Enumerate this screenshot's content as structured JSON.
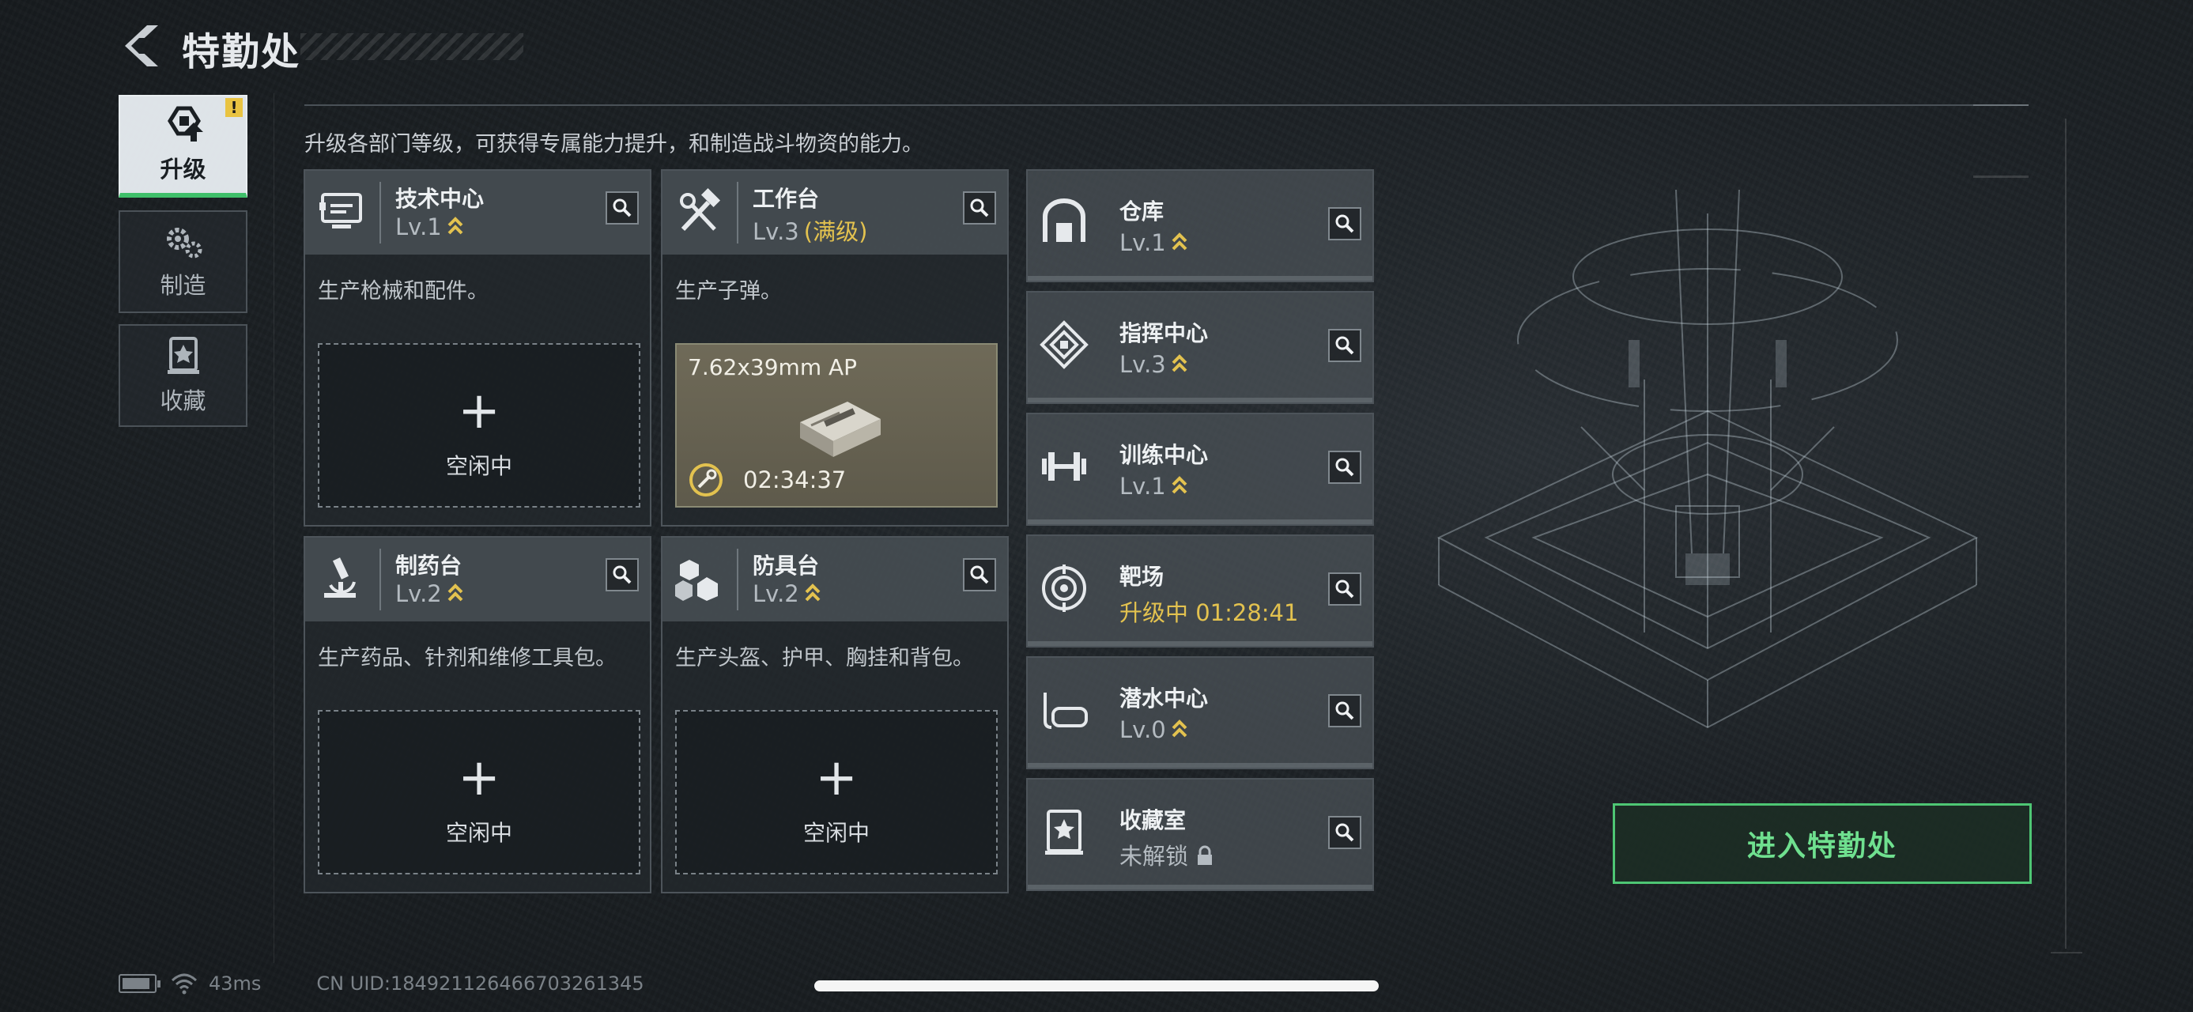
{
  "header": {
    "title": "特勤处"
  },
  "nav": {
    "items": [
      {
        "label": "升级",
        "active": true,
        "badge": "!"
      },
      {
        "label": "制造",
        "active": false
      },
      {
        "label": "收藏",
        "active": false
      }
    ]
  },
  "intro": "升级各部门等级，可获得专属能力提升，和制造战斗物资的能力。",
  "cards": [
    {
      "name": "技术中心",
      "level": "Lv.1",
      "desc": "生产枪械和配件。",
      "slot": {
        "state": "idle",
        "label": "空闲中",
        "plus": "+"
      }
    },
    {
      "name": "工作台",
      "level": "Lv.3",
      "max_label": "(满级)",
      "desc": "生产子弹。",
      "slot": {
        "state": "producing",
        "item": "7.62x39mm AP",
        "timer": "02:34:37"
      }
    },
    {
      "name": "制药台",
      "level": "Lv.2",
      "desc": "生产药品、针剂和维修工具包。",
      "slot": {
        "state": "idle",
        "label": "空闲中",
        "plus": "+"
      }
    },
    {
      "name": "防具台",
      "level": "Lv.2",
      "desc": "生产头盔、护甲、胸挂和背包。",
      "slot": {
        "state": "idle",
        "label": "空闲中",
        "plus": "+"
      }
    }
  ],
  "small_cards": [
    {
      "name": "仓库",
      "sub": "Lv.1",
      "icon": "warehouse-icon"
    },
    {
      "name": "指挥中心",
      "sub": "Lv.3",
      "icon": "command-center-icon"
    },
    {
      "name": "训练中心",
      "sub": "Lv.1",
      "icon": "dumbbell-icon"
    },
    {
      "name": "靶场",
      "sub": "升级中 01:28:41",
      "icon": "target-icon"
    },
    {
      "name": "潜水中心",
      "sub": "Lv.0",
      "icon": "diving-mask-icon"
    },
    {
      "name": "收藏室",
      "sub": "未解锁",
      "icon": "collection-room-icon"
    }
  ],
  "enter_button": "进入特勤处",
  "status": {
    "ping": "43ms",
    "uid": "CN UID:1849211264667032613​45"
  },
  "colors": {
    "accent_green": "#4ec674",
    "upgrade_yellow": "#e3c24f",
    "badge_yellow": "#e9c341"
  }
}
